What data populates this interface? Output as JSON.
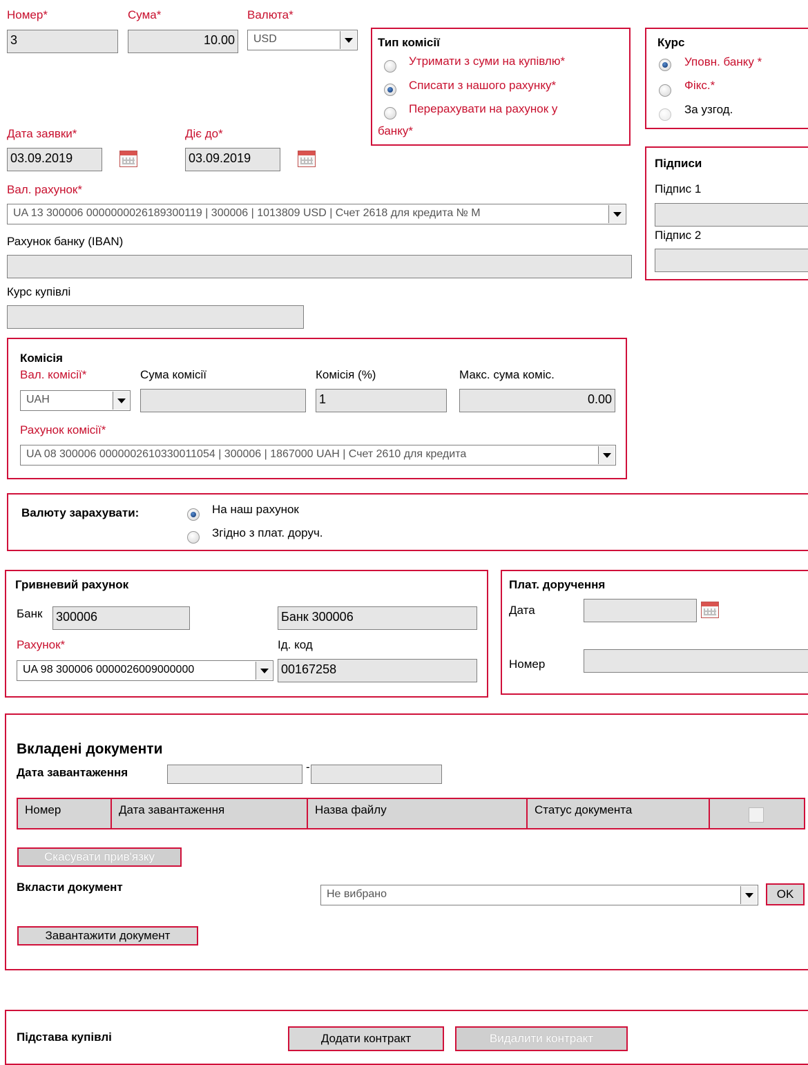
{
  "header": {
    "number_label": "Номер",
    "number_value": "3",
    "sum_label": "Сума",
    "sum_value": "10.00",
    "currency_label": "Валюта",
    "currency_value": "USD"
  },
  "commission_type": {
    "title": "Тип комісії",
    "options": [
      {
        "label": "Утримати з суми на купівлю",
        "selected": false
      },
      {
        "label": "Списати з нашого рахунку",
        "selected": true
      },
      {
        "label": "Перерахувати на рахунок у",
        "label2": "банку",
        "selected": false
      }
    ]
  },
  "rate": {
    "title": "Курс",
    "options": [
      {
        "label": "Уповн. банку",
        "selected": true
      },
      {
        "label": "Фікс.",
        "selected": false
      },
      {
        "label": "За узгод.",
        "selected": false
      }
    ]
  },
  "dates": {
    "request_date_label": "Дата заявки",
    "request_date_value": "03.09.2019",
    "valid_until_label": "Діє до",
    "valid_until_value": "03.09.2019"
  },
  "signatures": {
    "title": "Підписи",
    "sig1_label": "Підпис 1",
    "sig2_label": "Підпис 2"
  },
  "currency_account": {
    "label": "Вал. рахунок",
    "value": "UA 13 300006 0000000026189300119 | 300006 | 1013809 USD | Счет 2618 для кредита № М"
  },
  "bank_account": {
    "label": "Рахунок банку (IBAN)",
    "value": ""
  },
  "purchase_rate": {
    "label": "Курс купівлі",
    "value": ""
  },
  "commission": {
    "title": "Комісія",
    "currency_label": "Вал. комісії",
    "currency_value": "UAH",
    "sum_label": "Сума комісії",
    "sum_value": "",
    "percent_label": "Комісія (%)",
    "percent_value": "1",
    "max_label": "Макс. сума коміс.",
    "max_value": "0.00",
    "account_label": "Рахунок комісії",
    "account_value": "UA 08 300006 0000002610330011054 | 300006 | 1867000 UAH | Счет 2610 для кредита"
  },
  "credit_currency": {
    "label": "Валюту зарахувати:",
    "options": [
      {
        "label": "На наш рахунок",
        "selected": true
      },
      {
        "label": "Згідно з плат. доруч.",
        "selected": false
      }
    ]
  },
  "uah_account": {
    "title": "Гривневий рахунок",
    "bank_label": "Банк",
    "bank_value": "300006",
    "bank_name_value": "Банк 300006",
    "account_label": "Рахунок",
    "account_value": "UA 98 300006 0000026009000000",
    "id_code_label": "Ід. код",
    "id_code_value": "00167258"
  },
  "payment_order": {
    "title": "Плат. доручення",
    "date_label": "Дата",
    "date_value": "",
    "number_label": "Номер",
    "number_value": ""
  },
  "attached_docs": {
    "title": "Вкладені документи",
    "upload_date_label": "Дата завантаження",
    "date_separator": "-",
    "columns": [
      "Номер",
      "Дата завантаження",
      "Назва файлу",
      "Статус документа"
    ],
    "unlink_button": "Скасувати прив'язку",
    "attach_label": "Вкласти документ",
    "attach_select_value": "Не вибрано",
    "ok_button": "OK",
    "upload_button": "Завантажити документ"
  },
  "purchase_basis": {
    "label": "Підстава купівлі",
    "add_button": "Додати контракт",
    "delete_button": "Видалити контракт"
  }
}
